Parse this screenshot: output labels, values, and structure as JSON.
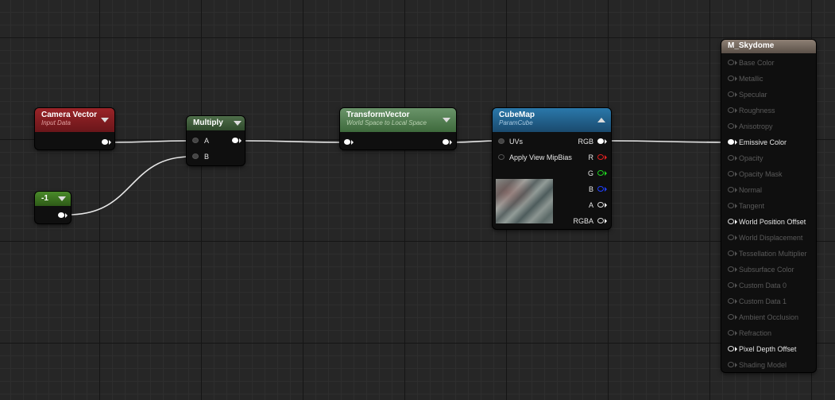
{
  "nodes": {
    "camera_vector": {
      "title": "Camera Vector",
      "subtitle": "Input Data",
      "color": "#8a1e22"
    },
    "constant": {
      "title": "-1",
      "color": "#3c6b22"
    },
    "multiply": {
      "title": "Multiply",
      "color": "#3f5a3b",
      "pins": {
        "a": "A",
        "b": "B"
      }
    },
    "transform_vector": {
      "title": "TransformVector",
      "subtitle": "World Space to Local Space",
      "color": "#4f7a4a"
    },
    "cubemap": {
      "title": "CubeMap",
      "subtitle": "ParamCube",
      "color": "#1d5a82",
      "inputs": {
        "uvs": "UVs",
        "mipbias": "Apply View MipBias"
      },
      "outputs": {
        "rgb": "RGB",
        "r": "R",
        "g": "G",
        "b": "B",
        "a": "A",
        "rgba": "RGBA"
      }
    },
    "material": {
      "title": "M_Skydome",
      "color": "#7a6e64",
      "pins": [
        {
          "label": "Base Color",
          "active": false
        },
        {
          "label": "Metallic",
          "active": false
        },
        {
          "label": "Specular",
          "active": false
        },
        {
          "label": "Roughness",
          "active": false
        },
        {
          "label": "Anisotropy",
          "active": false
        },
        {
          "label": "Emissive Color",
          "active": true,
          "connected": true
        },
        {
          "label": "Opacity",
          "active": false
        },
        {
          "label": "Opacity Mask",
          "active": false
        },
        {
          "label": "Normal",
          "active": false
        },
        {
          "label": "Tangent",
          "active": false
        },
        {
          "label": "World Position Offset",
          "active": true,
          "connected": false
        },
        {
          "label": "World Displacement",
          "active": false
        },
        {
          "label": "Tessellation Multiplier",
          "active": false
        },
        {
          "label": "Subsurface Color",
          "active": false
        },
        {
          "label": "Custom Data 0",
          "active": false
        },
        {
          "label": "Custom Data 1",
          "active": false
        },
        {
          "label": "Ambient Occlusion",
          "active": false
        },
        {
          "label": "Refraction",
          "active": false
        },
        {
          "label": "Pixel Depth Offset",
          "active": true,
          "connected": false
        },
        {
          "label": "Shading Model",
          "active": false
        }
      ]
    }
  }
}
